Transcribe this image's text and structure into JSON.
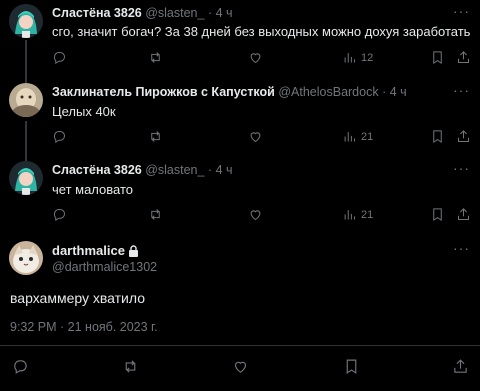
{
  "tweets": [
    {
      "name": "Сластёна 3826",
      "handle": "@slasten_",
      "sep": "·",
      "time": "4 ч",
      "text": "сго, значит богач? За 38 дней без выходных можно дохуя заработать",
      "views": "12"
    },
    {
      "name": "Заклинатель Пирожков с Капусткой",
      "handle": "@AthelosBardock",
      "sep": "·",
      "time": "4 ч",
      "text": "Целых 40к",
      "views": "21"
    },
    {
      "name": "Сластёна 3826",
      "handle": "@slasten_",
      "sep": "·",
      "time": "4 ч",
      "text": "чет маловато",
      "views": "21"
    }
  ],
  "main_tweet": {
    "name": "darthmalice",
    "handle": "@darthmalice1302",
    "text": "вархаммеру хватило",
    "timestamp": "9:32 PM · 21 нояб. 2023 г."
  },
  "more_glyph": "···",
  "colors": {
    "background": "#000000",
    "text": "#e7e9ea",
    "muted": "#71767b",
    "divider": "#2f3336"
  },
  "icons": [
    "reply-icon",
    "retweet-icon",
    "like-icon",
    "views-icon",
    "bookmark-icon",
    "share-icon",
    "lock-icon",
    "more-icon"
  ]
}
